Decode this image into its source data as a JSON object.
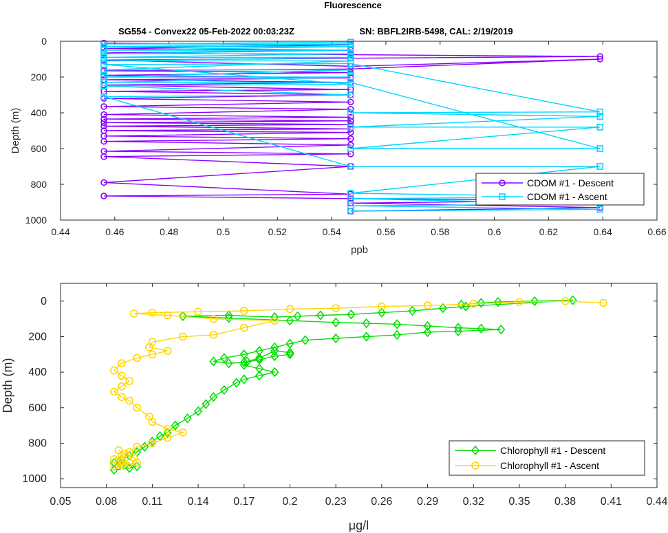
{
  "figure": {
    "title": "Fluorescence",
    "subtitle_left": "SG554 - Convex22 05-Feb-2022 00:03:23Z",
    "subtitle_right": "SN: BBFL2IRB-5498, CAL: 2/19/2019"
  },
  "chart_data": [
    {
      "type": "line",
      "xlabel": "ppb",
      "ylabel": "Depth (m)",
      "xlim": [
        0.44,
        0.66
      ],
      "ylim": [
        1000,
        0
      ],
      "y_reversed": true,
      "xticks": [
        "0.44",
        "0.46",
        "0.48",
        "0.5",
        "0.52",
        "0.54",
        "0.56",
        "0.58",
        "0.6",
        "0.62",
        "0.64",
        "0.66"
      ],
      "yticks": [
        "0",
        "200",
        "400",
        "600",
        "800",
        "1000"
      ],
      "legend_position": "bottom-right",
      "series": [
        {
          "name": "CDOM #1 - Descent",
          "color": "#8b00ff",
          "marker": "circle",
          "x": [
            0.456,
            0.547,
            0.456,
            0.547,
            0.456,
            0.547,
            0.639,
            0.547,
            0.456,
            0.547,
            0.639,
            0.547,
            0.456,
            0.547,
            0.456,
            0.547,
            0.456,
            0.547,
            0.456,
            0.547,
            0.456,
            0.547,
            0.456,
            0.547,
            0.456,
            0.547,
            0.456,
            0.547,
            0.456,
            0.547,
            0.456,
            0.547,
            0.456,
            0.547,
            0.456,
            0.547,
            0.456,
            0.547,
            0.456,
            0.547,
            0.456,
            0.547,
            0.456,
            0.547,
            0.456,
            0.547,
            0.456,
            0.547,
            0.639,
            0.547,
            0.639,
            0.547
          ],
          "y": [
            10,
            20,
            40,
            50,
            65,
            75,
            85,
            95,
            105,
            140,
            100,
            155,
            165,
            175,
            190,
            205,
            215,
            230,
            245,
            270,
            280,
            300,
            320,
            340,
            365,
            380,
            410,
            425,
            435,
            445,
            455,
            465,
            475,
            490,
            500,
            510,
            530,
            545,
            560,
            580,
            615,
            630,
            645,
            700,
            790,
            855,
            865,
            880,
            890,
            905,
            930,
            950
          ]
        },
        {
          "name": "CDOM #1 - Ascent",
          "color": "#00d5ff",
          "marker": "square",
          "x": [
            0.547,
            0.639,
            0.547,
            0.639,
            0.547,
            0.639,
            0.547,
            0.639,
            0.547,
            0.456,
            0.547,
            0.456,
            0.547,
            0.456,
            0.547,
            0.639,
            0.547,
            0.639,
            0.547,
            0.639,
            0.547,
            0.639,
            0.547,
            0.456,
            0.547,
            0.456,
            0.547,
            0.456,
            0.547,
            0.456,
            0.547,
            0.456,
            0.547,
            0.456,
            0.547,
            0.456,
            0.547,
            0.456,
            0.547,
            0.456,
            0.547
          ],
          "y": [
            950,
            940,
            920,
            910,
            880,
            870,
            850,
            700,
            700,
            310,
            300,
            250,
            240,
            130,
            125,
            395,
            400,
            420,
            480,
            480,
            600,
            600,
            230,
            230,
            200,
            200,
            160,
            160,
            110,
            110,
            90,
            90,
            70,
            70,
            50,
            50,
            30,
            30,
            15,
            15,
            5
          ]
        }
      ]
    },
    {
      "type": "line",
      "xlabel": "μg/l",
      "ylabel": "Depth (m)",
      "xlim": [
        0.05,
        0.44
      ],
      "ylim": [
        1050,
        -100
      ],
      "y_reversed": true,
      "xticks": [
        "0.05",
        "0.08",
        "0.11",
        "0.14",
        "0.17",
        "0.2",
        "0.23",
        "0.26",
        "0.29",
        "0.32",
        "0.35",
        "0.38",
        "0.41",
        "0.44"
      ],
      "yticks": [
        "0",
        "200",
        "400",
        "600",
        "800",
        "1000"
      ],
      "legend_position": "bottom-right",
      "series": [
        {
          "name": "Chlorophyll #1 - Descent",
          "color": "#00e000",
          "marker": "diamond",
          "x": [
            0.312,
            0.325,
            0.336,
            0.36,
            0.385,
            0.315,
            0.3,
            0.28,
            0.26,
            0.24,
            0.22,
            0.205,
            0.19,
            0.16,
            0.13,
            0.16,
            0.2,
            0.23,
            0.25,
            0.27,
            0.29,
            0.31,
            0.325,
            0.338,
            0.31,
            0.29,
            0.27,
            0.25,
            0.23,
            0.21,
            0.2,
            0.19,
            0.18,
            0.17,
            0.157,
            0.15,
            0.16,
            0.17,
            0.18,
            0.19,
            0.2,
            0.2,
            0.19,
            0.18,
            0.172,
            0.17,
            0.18,
            0.19,
            0.18,
            0.17,
            0.165,
            0.157,
            0.15,
            0.145,
            0.14,
            0.133,
            0.125,
            0.12,
            0.115,
            0.11,
            0.105,
            0.1,
            0.095,
            0.09,
            0.085,
            0.09,
            0.1,
            0.095,
            0.085
          ],
          "y": [
            20,
            10,
            5,
            0,
            -5,
            30,
            40,
            55,
            65,
            75,
            80,
            85,
            90,
            80,
            85,
            95,
            110,
            120,
            125,
            130,
            140,
            150,
            155,
            160,
            170,
            175,
            190,
            200,
            210,
            220,
            240,
            260,
            280,
            300,
            320,
            340,
            350,
            345,
            330,
            310,
            300,
            290,
            280,
            320,
            340,
            360,
            380,
            400,
            420,
            440,
            460,
            500,
            540,
            580,
            620,
            660,
            700,
            740,
            760,
            790,
            820,
            850,
            870,
            890,
            910,
            920,
            930,
            940,
            950
          ]
        },
        {
          "name": "Chlorophyll #1 - Ascent",
          "color": "#ffd700",
          "marker": "circle",
          "x": [
            0.405,
            0.38,
            0.35,
            0.32,
            0.29,
            0.26,
            0.23,
            0.2,
            0.17,
            0.14,
            0.11,
            0.098,
            0.12,
            0.15,
            0.19,
            0.17,
            0.15,
            0.13,
            0.11,
            0.108,
            0.12,
            0.11,
            0.1,
            0.09,
            0.085,
            0.09,
            0.095,
            0.09,
            0.085,
            0.09,
            0.095,
            0.1,
            0.108,
            0.11,
            0.12,
            0.13,
            0.12,
            0.11,
            0.1,
            0.095,
            0.09,
            0.085,
            0.09,
            0.095,
            0.09,
            0.085,
            0.09,
            0.1,
            0.098,
            0.092,
            0.088
          ],
          "y": [
            10,
            0,
            5,
            15,
            25,
            30,
            40,
            45,
            55,
            60,
            65,
            70,
            80,
            100,
            110,
            150,
            190,
            200,
            230,
            260,
            280,
            300,
            320,
            350,
            390,
            420,
            450,
            480,
            510,
            540,
            560,
            600,
            650,
            680,
            720,
            740,
            770,
            800,
            820,
            850,
            870,
            890,
            900,
            910,
            920,
            930,
            925,
            910,
            880,
            860,
            840
          ]
        }
      ]
    }
  ]
}
